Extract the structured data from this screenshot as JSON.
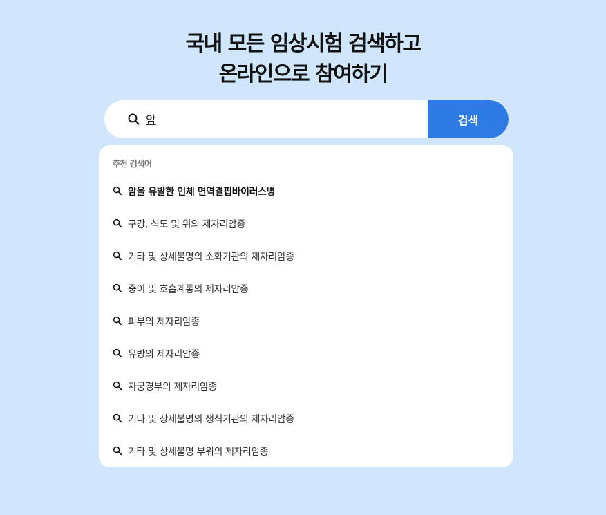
{
  "headline": {
    "line1": "국내 모든 임상시험 검색하고",
    "line2": "온라인으로 참여하기"
  },
  "search": {
    "query": "암",
    "button_label": "검색"
  },
  "dropdown": {
    "heading": "추천 검색어",
    "suggestions": [
      "암을 유발한 인체 면역결핍바이러스병",
      "구강, 식도 및 위의 제자리암종",
      "기타 및 상세불명의 소화기관의 제자리암종",
      "중이 및 호흡계통의 제자리암종",
      "피부의 제자리암종",
      "유방의 제자리암종",
      "자궁경부의 제자리암종",
      "기타 및 상세불명의 생식기관의 제자리암종",
      "기타 및 상세불명 부위의 제자리암종"
    ]
  },
  "colors": {
    "background": "#cfe6fd",
    "button": "#2f7be5",
    "panel": "#ffffff"
  },
  "icons": {
    "search": "search-icon"
  }
}
